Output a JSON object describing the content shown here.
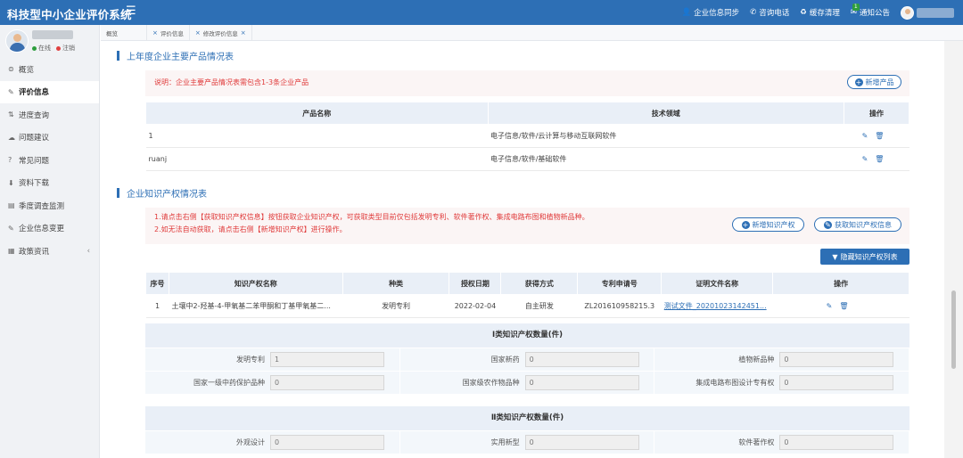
{
  "header": {
    "title": "科技型中小企业评价系统",
    "menu_icon": "☰",
    "actions": [
      {
        "icon": "user-icon",
        "label": "企业信息同步"
      },
      {
        "icon": "phone-icon",
        "label": "咨询电话"
      },
      {
        "icon": "recycle-icon",
        "label": "缓存清理"
      },
      {
        "icon": "mail-icon",
        "label": "通知公告",
        "badge": "1"
      }
    ]
  },
  "user": {
    "online": "在线",
    "logout": "注销"
  },
  "sidebar": {
    "items": [
      {
        "icon": "⊜",
        "label": "概览"
      },
      {
        "icon": "✎",
        "label": "评价信息"
      },
      {
        "icon": "⇅",
        "label": "进度查询"
      },
      {
        "icon": "☁",
        "label": "问题建议"
      },
      {
        "icon": "?",
        "label": "常见问题"
      },
      {
        "icon": "⬇",
        "label": "资料下载"
      },
      {
        "icon": "▤",
        "label": "季度调查监测"
      },
      {
        "icon": "✎",
        "label": "企业信息变更"
      },
      {
        "icon": "▦",
        "label": "政策资讯"
      }
    ]
  },
  "tabs": [
    {
      "label": "概览"
    },
    {
      "label": "评价信息"
    },
    {
      "label": "修改评价信息"
    }
  ],
  "products": {
    "section_title": "上年度企业主要产品情况表",
    "note": "说明：企业主要产品情况表需包含1-3条企业产品",
    "add_button": "新增产品",
    "headers": [
      "产品名称",
      "技术领域",
      "操作"
    ],
    "rows": [
      {
        "name": "1",
        "field": "电子信息/软件/云计算与移动互联网软件"
      },
      {
        "name": "ruanj",
        "field": "电子信息/软件/基础软件"
      }
    ]
  },
  "ip": {
    "section_title": "企业知识产权情况表",
    "note1": "1.请点击右侧【获取知识产权信息】按钮获取企业知识产权，可获取类型目前仅包括发明专利、软件著作权、集成电路布图和植物新品种。",
    "note2": "2.如无法自动获取，请点击右侧【新增知识产权】进行操作。",
    "add_button": "新增知识产权",
    "fetch_button": "获取知识产权信息",
    "hide_button": "隐藏知识产权列表",
    "headers": [
      "序号",
      "知识产权名称",
      "种类",
      "授权日期",
      "获得方式",
      "专利申请号",
      "证明文件名称",
      "操作"
    ],
    "rows": [
      {
        "no": "1",
        "name": "土壤中2-羟基-4-甲氧基二苯甲酮和丁基甲氧基二...",
        "type": "发明专利",
        "date": "2022-02-04",
        "method": "自主研发",
        "app_no": "ZL201610958215.3",
        "file": "测试文件_20201023142451..."
      }
    ]
  },
  "class1": {
    "title": "Ⅰ类知识产权数量(件)",
    "fields": [
      {
        "label": "发明专利",
        "value": "1"
      },
      {
        "label": "国家新药",
        "value": "0"
      },
      {
        "label": "植物新品种",
        "value": "0"
      },
      {
        "label": "国家一级中药保护品种",
        "value": "0"
      },
      {
        "label": "国家级农作物品种",
        "value": "0"
      },
      {
        "label": "集成电路布图设计专有权",
        "value": "0"
      }
    ]
  },
  "class2": {
    "title": "Ⅱ类知识产权数量(件)",
    "fields": [
      {
        "label": "外观设计",
        "value": "0"
      },
      {
        "label": "实用新型",
        "value": "0"
      },
      {
        "label": "软件著作权",
        "value": "0"
      }
    ]
  }
}
